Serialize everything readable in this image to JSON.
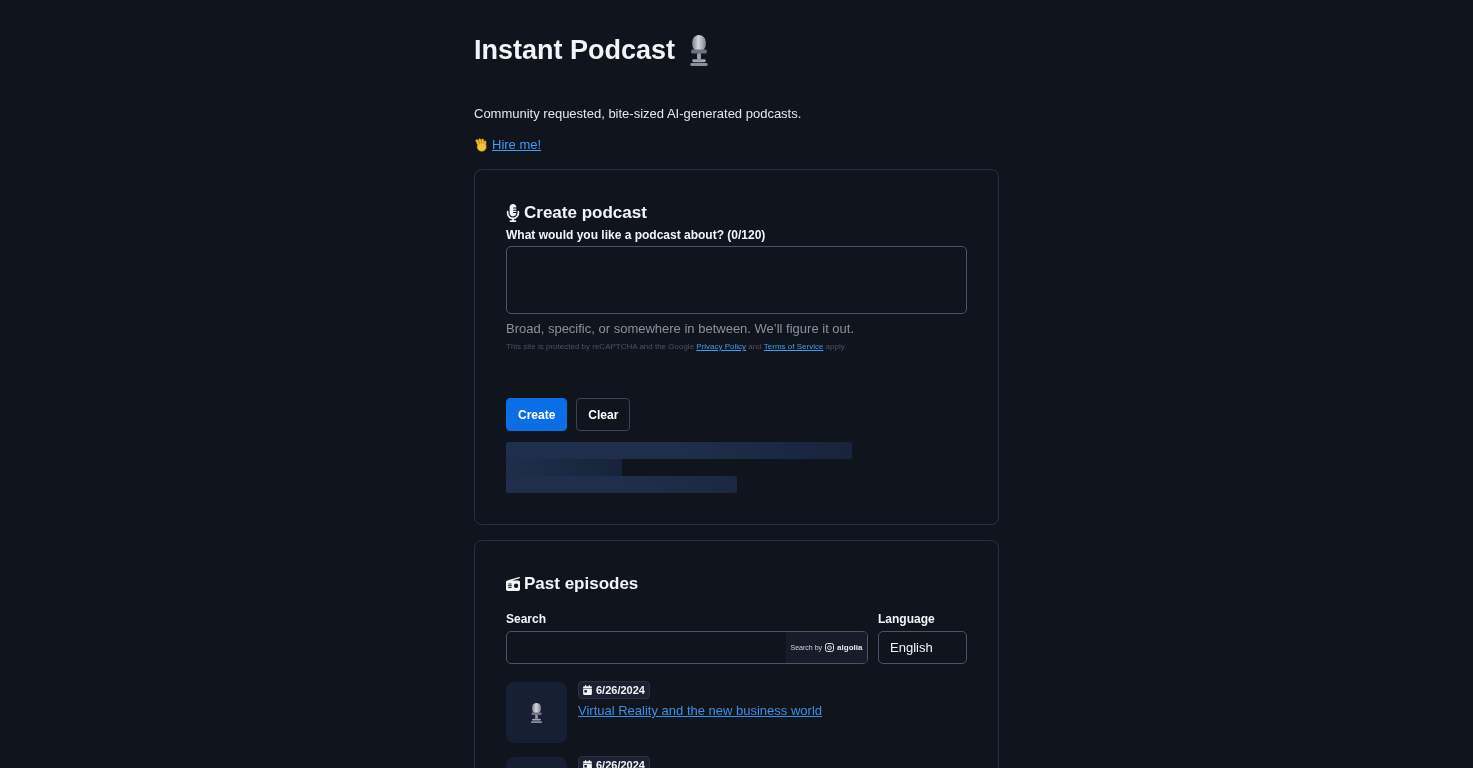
{
  "header": {
    "title": "Instant Podcast",
    "tagline": "Community requested, bite-sized AI-generated podcasts.",
    "hire_link": "Hire me!"
  },
  "create_card": {
    "title": "Create podcast",
    "prompt_label": "What would you like a podcast about? (0/120)",
    "hint": "Broad, specific, or somewhere in between. We’ll figure it out.",
    "recaptcha": {
      "before": "This site is protected by reCAPTCHA and the Google",
      "privacy_link": "Privacy Policy",
      "middle": "and",
      "terms_link": "Terms of Service",
      "after": "apply."
    },
    "buttons": [
      {
        "label": "Create",
        "kind": "primary"
      },
      {
        "label": "Clear",
        "kind": "outline"
      }
    ],
    "loading": true
  },
  "past_episodes": {
    "title": "Past episodes",
    "search": {
      "label": "Search",
      "attribution": "Search by",
      "brand": "algolia"
    },
    "language": {
      "label": "Language",
      "value": "English"
    },
    "episodes": [
      {
        "date": "6/26/2024",
        "title": "Virtual Reality and the new business world"
      },
      {
        "date": "6/26/2024"
      }
    ]
  }
}
